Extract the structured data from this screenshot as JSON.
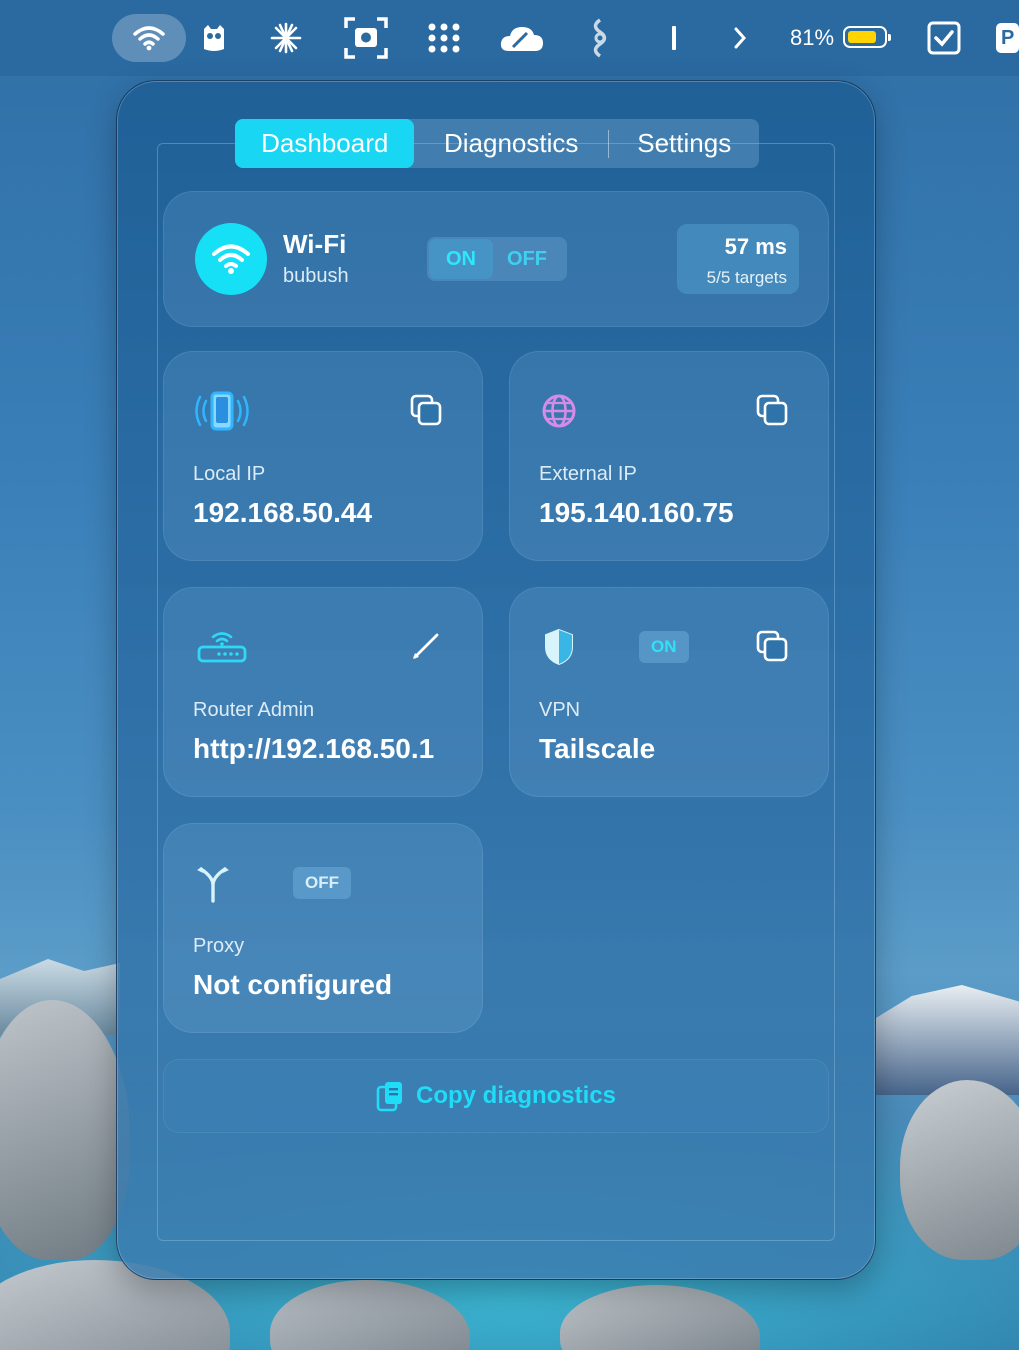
{
  "menubar": {
    "battery_percent": "81%",
    "battery_level": 0.81,
    "last_item_label": "P",
    "icons": [
      "wifi-icon",
      "owl-icon",
      "sparkle-icon",
      "screenshot-icon",
      "dots-grid-icon",
      "cloud-icon",
      "sync-icon",
      "text-cursor-icon",
      "chevron-right-icon",
      "battery-icon",
      "checkbox-icon",
      "app-icon"
    ]
  },
  "tabs": [
    {
      "label": "Dashboard",
      "active": true
    },
    {
      "label": "Diagnostics",
      "active": false
    },
    {
      "label": "Settings",
      "active": false
    }
  ],
  "wifi": {
    "title": "Wi-Fi",
    "ssid": "bubush",
    "toggle_on": "ON",
    "toggle_off": "OFF",
    "latency": "57 ms",
    "targets": "5/5 targets"
  },
  "tiles": {
    "local_ip": {
      "label": "Local IP",
      "value": "192.168.50.44",
      "icon": "phone-signal-icon",
      "action": "copy-icon"
    },
    "external_ip": {
      "label": "External IP",
      "value": "195.140.160.75",
      "icon": "globe-icon",
      "action": "copy-icon"
    },
    "router": {
      "label": "Router Admin",
      "value": "http://192.168.50.1",
      "icon": "router-icon",
      "action": "pencil-icon"
    },
    "vpn": {
      "label": "VPN",
      "value": "Tailscale",
      "badge": "ON",
      "icon": "shield-icon",
      "action": "copy-icon"
    },
    "proxy": {
      "label": "Proxy",
      "value": "Not configured",
      "badge": "OFF",
      "icon": "fork-icon"
    }
  },
  "copy_diagnostics": {
    "label": "Copy diagnostics",
    "icon": "clipboard-icon"
  },
  "colors": {
    "accent": "#19d6f2",
    "battery": "#ffd400",
    "globe": "#d58be8"
  }
}
